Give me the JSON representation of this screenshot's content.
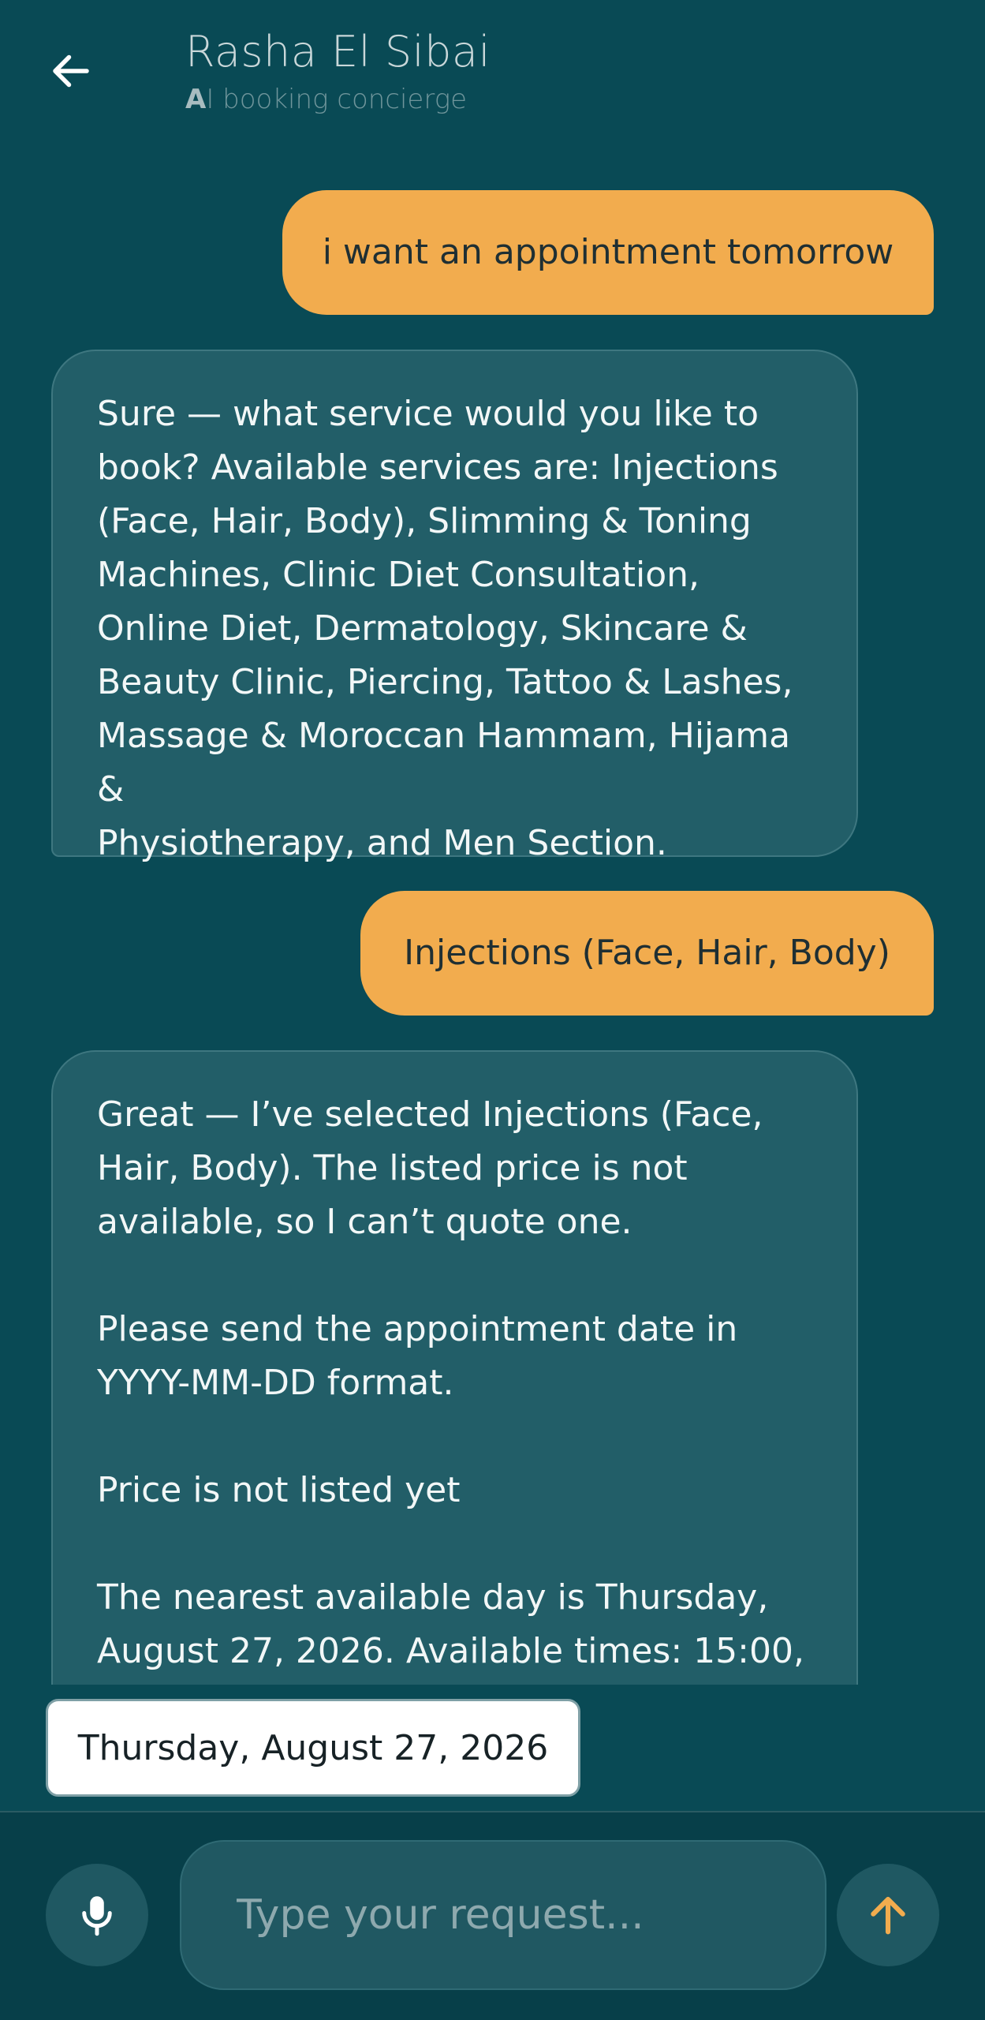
{
  "header": {
    "back_icon": "arrow-left-icon",
    "title": "Rasha El Sibai",
    "subtitle_first": "A",
    "subtitle_rest": "I booking concierge"
  },
  "messages": [
    {
      "role": "user",
      "text": "i want an appointment tomorrow"
    },
    {
      "role": "assistant",
      "text": "Sure — what service would you like to\nbook? Available services are: Injections\n(Face, Hair, Body), Slimming & Toning\nMachines, Clinic Diet Consultation,\nOnline Diet, Dermatology, Skincare &\nBeauty Clinic, Piercing, Tattoo & Lashes,\nMassage & Moroccan Hammam, Hijama &\nPhysiotherapy, and Men Section."
    },
    {
      "role": "user",
      "text": "Injections (Face, Hair, Body)"
    },
    {
      "role": "assistant",
      "text": "Great — I’ve selected Injections (Face,\nHair, Body). The listed price is not\navailable, so I can’t quote one.\n\nPlease send the appointment date in\nYYYY-MM-DD format.\n\nPrice is not listed yet\n\nThe nearest available day is Thursday,\nAugust 27, 2026. Available times: 15:00,"
    }
  ],
  "suggestion": {
    "label": "Thursday, August 27, 2026"
  },
  "composer": {
    "placeholder": "Type your request...",
    "mic_icon": "microphone-icon",
    "send_icon": "arrow-up-icon"
  },
  "colors": {
    "background": "#094A55",
    "user_bubble": "#F2AC4E",
    "assistant_bubble": "#225E68",
    "accent": "#F2AC4E"
  }
}
